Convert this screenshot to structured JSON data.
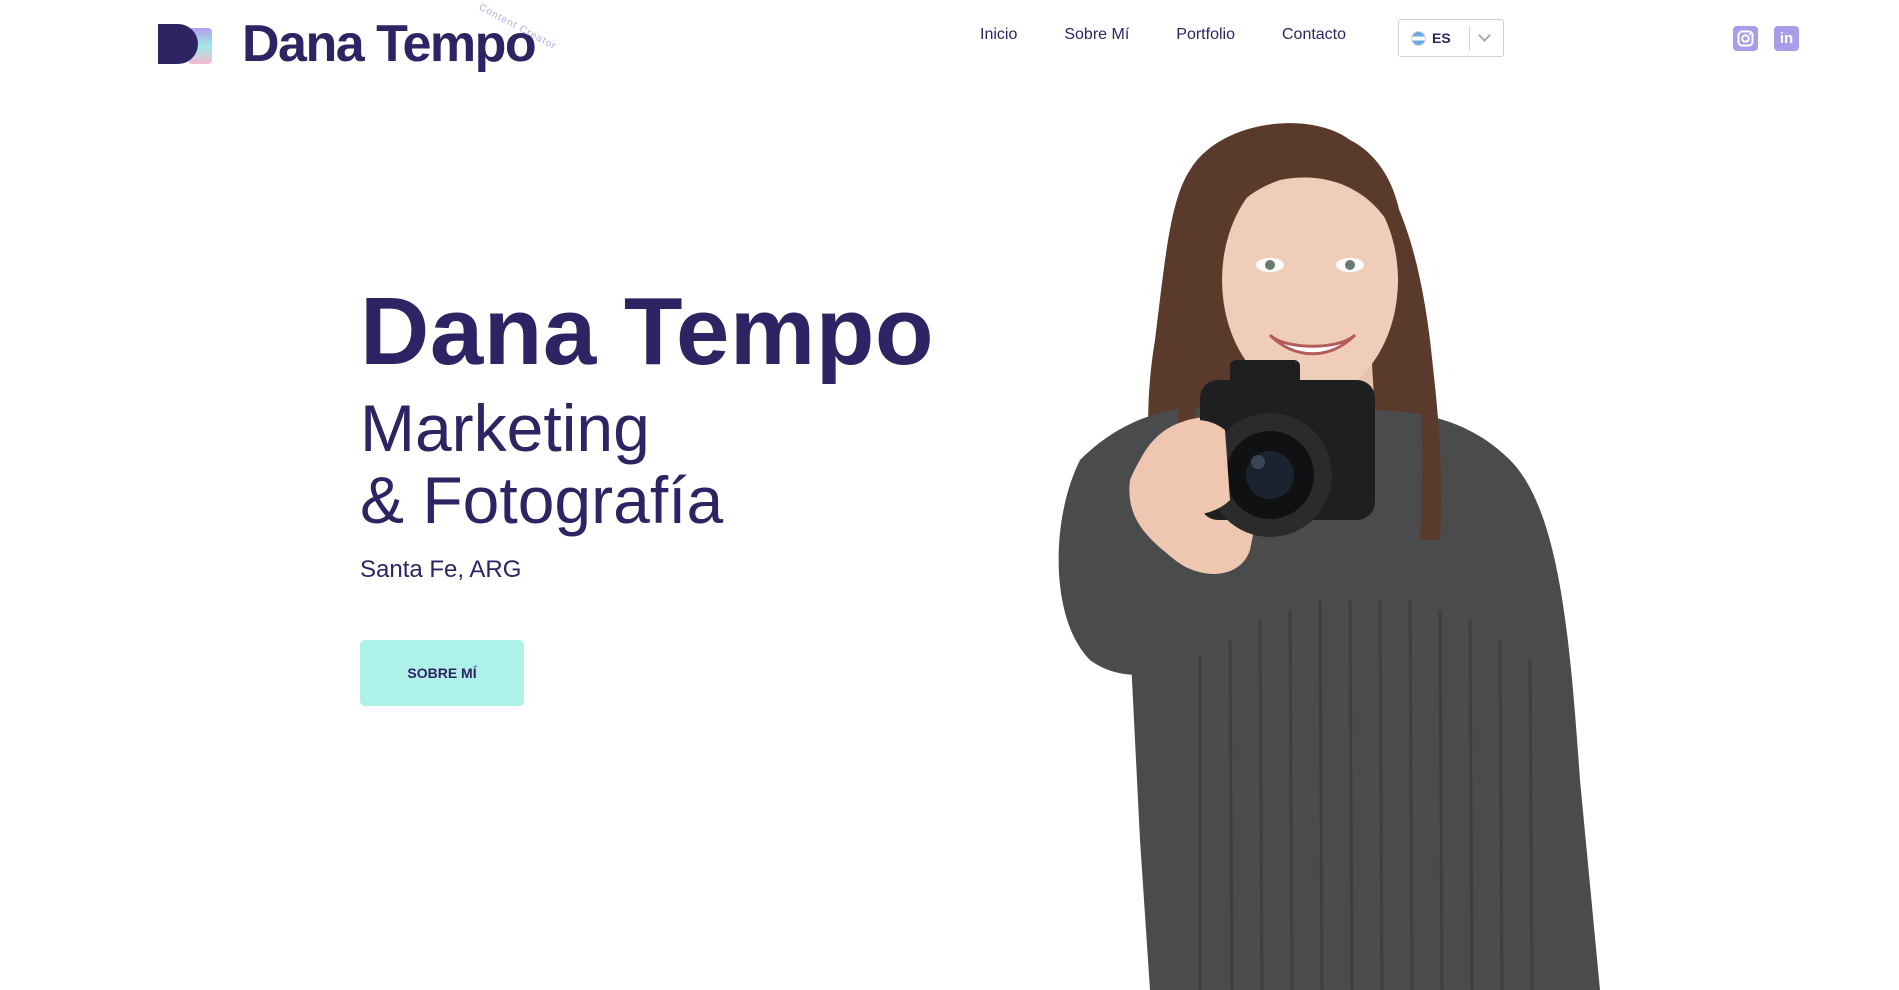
{
  "brand": {
    "name": "Dana Tempo",
    "tagline": "Content Creator",
    "colors": {
      "primary": "#2d2463",
      "accent": "#aef1e9",
      "social": "#a99ce9"
    }
  },
  "nav": {
    "items": [
      "Inicio",
      "Sobre Mí",
      "Portfolio",
      "Contacto"
    ]
  },
  "language": {
    "code": "ES",
    "icon": "argentina-flag-icon"
  },
  "social": {
    "icons": [
      "instagram-icon",
      "linkedin-icon"
    ],
    "linkedin_label": "in"
  },
  "hero": {
    "title": "Dana Tempo",
    "subtitle_line1": "Marketing",
    "subtitle_line2": "& Fotografía",
    "location": "Santa Fe, ARG",
    "cta": "SOBRE MÍ"
  }
}
